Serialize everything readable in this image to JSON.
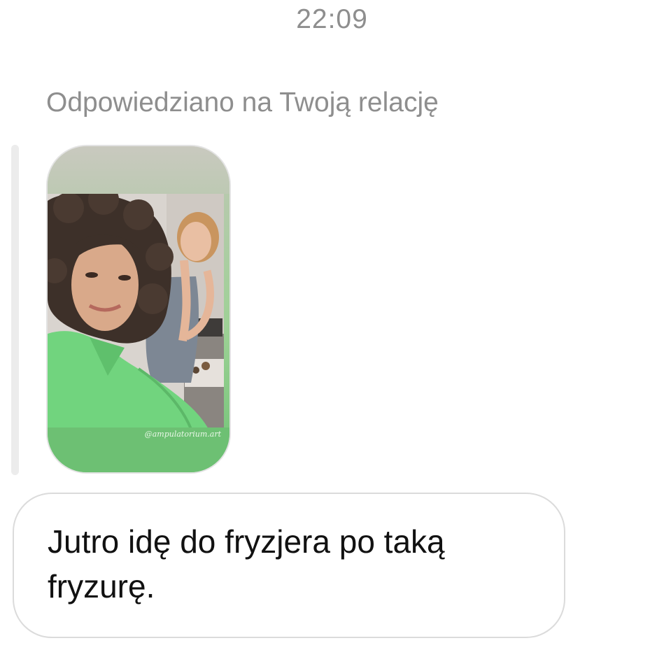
{
  "thread": {
    "timestamp": "22:09",
    "reply_caption": "Odpowiedziano na Twoją relację"
  },
  "story_reply": {
    "credit": "@ampulatorium.art",
    "image_icon": "story-photo-two-women-selfie"
  },
  "message": {
    "text": "Jutro idę do fryzjera po taką fryzurę."
  },
  "colors": {
    "meta_text": "#8e8e8e",
    "bubble_border": "#dbdbdb",
    "story_green": "#6dc073"
  }
}
